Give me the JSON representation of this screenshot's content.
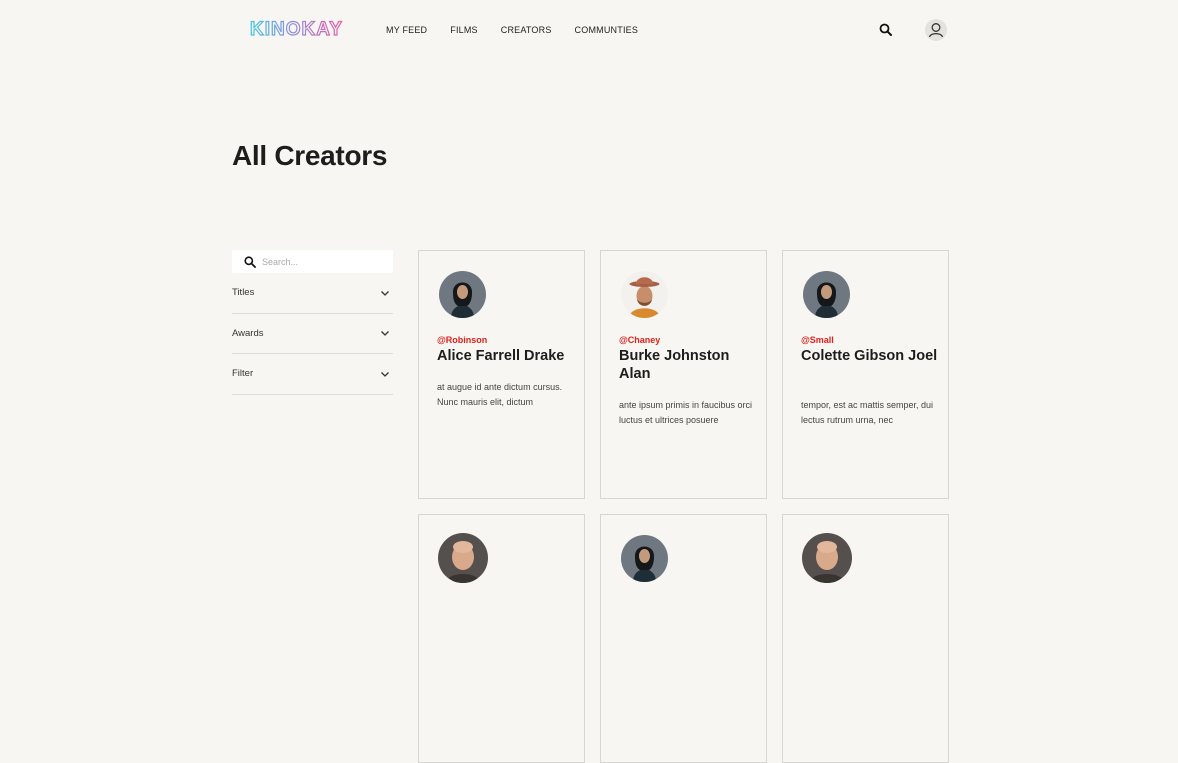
{
  "header": {
    "logo_text": "KINOKAY",
    "nav": [
      "MY FEED",
      "FILMS",
      "CREATORS",
      "COMMUNTIES"
    ]
  },
  "page": {
    "title": "All Creators"
  },
  "sidebar": {
    "search_placeholder": "Search...",
    "filters": [
      "Titles",
      "Awards",
      "Filter"
    ]
  },
  "creators": [
    {
      "handle": "@Robinson",
      "name": "Alice Farrell Drake",
      "bio": "at augue id ante dictum cursus. Nunc mauris elit, dictum",
      "avatar": "woman-portrait"
    },
    {
      "handle": "@Chaney",
      "name": "Burke Johnston Alan",
      "bio": "ante ipsum primis in faucibus orci luctus et ultrices posuere",
      "avatar": "man-hat-portrait"
    },
    {
      "handle": "@Small",
      "name": "Colette Gibson Joel",
      "bio": "tempor, est ac mattis semper, dui lectus rutrum urna, nec",
      "avatar": "woman-portrait"
    },
    {
      "handle": "",
      "name": "",
      "bio": "",
      "avatar": "bald-man-portrait"
    },
    {
      "handle": "",
      "name": "",
      "bio": "",
      "avatar": "woman-portrait"
    },
    {
      "handle": "",
      "name": "",
      "bio": "",
      "avatar": "bald-man-portrait"
    }
  ],
  "colors": {
    "background": "#f7f6f3",
    "handle_red": "#e0201b",
    "logo_cyan": "#38c6e0",
    "logo_pink": "#e55aa8"
  }
}
